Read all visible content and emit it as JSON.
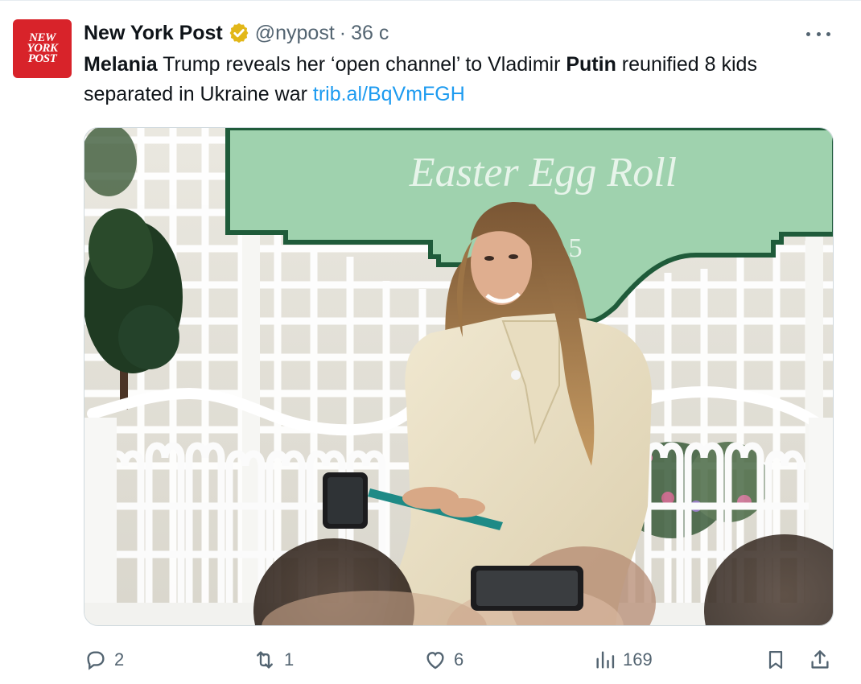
{
  "account": {
    "avatar_text": [
      "NEW",
      "YORK",
      "POST"
    ],
    "name": "New York Post",
    "handle": "@nypost",
    "separator": "·",
    "time": "36 с"
  },
  "tweet": {
    "bold_1": "Melania",
    "text_1": " Trump reveals her ‘open channel’ to Vladimir ",
    "bold_2": "Putin",
    "text_2": " reunified 8 kids separated in Ukraine war ",
    "link": "trib.al/BqVmFGH"
  },
  "media": {
    "sign_text": "Easter Egg Roll",
    "sign_partial": "5"
  },
  "actions": {
    "replies": "2",
    "reposts": "1",
    "likes": "6",
    "views": "169"
  },
  "colors": {
    "accent": "#1d9bf0",
    "muted": "#536471",
    "brand_red": "#d8232a",
    "verified_gold": "#e2b719"
  }
}
